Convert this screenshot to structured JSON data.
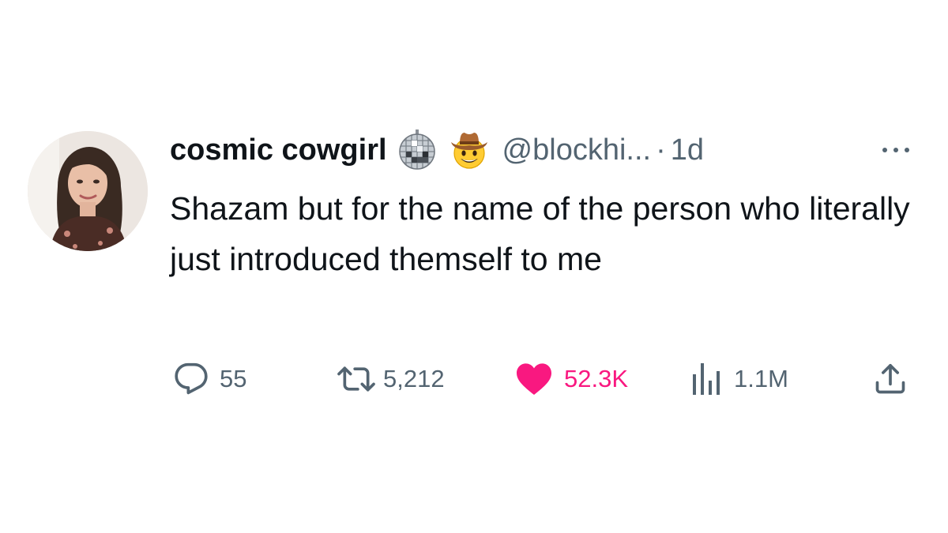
{
  "tweet": {
    "display_name": "cosmic cowgirl",
    "name_emojis": [
      "mirror-ball-emoji",
      "cowboy-hat-face-emoji"
    ],
    "handle": "@blockhi...",
    "separator": "·",
    "time": "1d",
    "text": "Shazam but for the name of the person who literally just introduced themself to me"
  },
  "actions": {
    "replies": "55",
    "reposts": "5,212",
    "likes": "52.3K",
    "views": "1.1M"
  },
  "icons": {
    "reply": "speech-bubble-icon",
    "repost": "retweet-arrows-icon",
    "like": "heart-icon-filled",
    "views": "bar-chart-icon",
    "share": "upload-arrow-icon",
    "more": "ellipsis-icon"
  },
  "colors": {
    "text_primary": "#0f1419",
    "text_secondary": "#536471",
    "like_pink": "#f91880"
  }
}
